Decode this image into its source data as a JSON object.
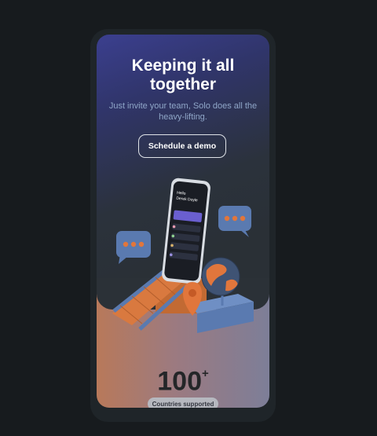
{
  "hero": {
    "title_line1": "Keeping it all",
    "title_line2": "together",
    "subtitle_line1": "Just invite your team, Solo does all the",
    "subtitle_line2": "heavy-lifting.",
    "cta_label": "Schedule a demo"
  },
  "stats": {
    "value": "100",
    "suffix": "+",
    "label": "Countries supported"
  },
  "colors": {
    "accent_orange": "#e1763c",
    "slate_blue": "#5a7ab0",
    "card_gradient_top": "#3b3f8f",
    "card_dark": "#2b323c"
  },
  "icons": [
    "chat-bubble-icon",
    "globe-icon",
    "location-pin-icon",
    "smartphone-icon",
    "staircase-icon"
  ]
}
